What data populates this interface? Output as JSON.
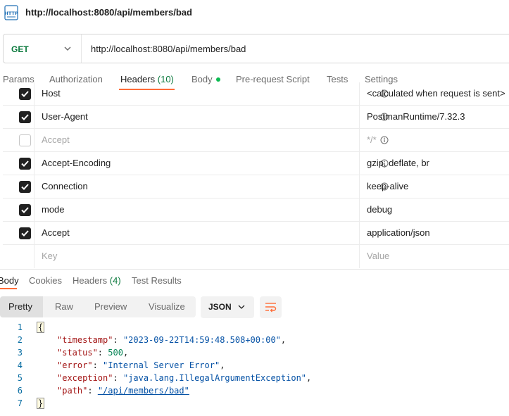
{
  "window": {
    "title": "http://localhost:8080/api/members/bad",
    "icon": "http-file-icon"
  },
  "request": {
    "method": "GET",
    "url": "http://localhost:8080/api/members/bad"
  },
  "request_tabs": [
    {
      "label": "Params"
    },
    {
      "label": "Authorization"
    },
    {
      "label": "Headers",
      "count": "(10)"
    },
    {
      "label": "Body"
    },
    {
      "label": "Pre-request Script"
    },
    {
      "label": "Tests"
    },
    {
      "label": "Settings"
    }
  ],
  "headers": [
    {
      "key": "Host",
      "value": "<calculated when request is sent>",
      "checked": true,
      "info": true
    },
    {
      "key": "User-Agent",
      "value": "PostmanRuntime/7.32.3",
      "checked": true,
      "info": true
    },
    {
      "key": "Accept",
      "value": "*/*",
      "checked": false,
      "info": true
    },
    {
      "key": "Accept-Encoding",
      "value": "gzip, deflate, br",
      "checked": true,
      "info": true
    },
    {
      "key": "Connection",
      "value": "keep-alive",
      "checked": true,
      "info": true
    },
    {
      "key": "mode",
      "value": "debug",
      "checked": true,
      "info": false
    },
    {
      "key": "Accept",
      "value": "application/json",
      "checked": true,
      "info": false
    }
  ],
  "new_header": {
    "key_placeholder": "Key",
    "value_placeholder": "Value"
  },
  "response_tabs": [
    {
      "label": "Body"
    },
    {
      "label": "Cookies"
    },
    {
      "label": "Headers",
      "count": "(4)"
    },
    {
      "label": "Test Results"
    }
  ],
  "format": {
    "options": [
      "Pretty",
      "Raw",
      "Preview",
      "Visualize"
    ],
    "selected": "Pretty",
    "language": "JSON"
  },
  "response_body": {
    "line_numbers": [
      "1",
      "2",
      "3",
      "4",
      "5",
      "6",
      "7"
    ],
    "open_brace": "{",
    "close_brace": "}",
    "fields": [
      {
        "key": "\"timestamp\"",
        "value": "\"2023-09-22T14:59:48.508+00:00\"",
        "trail": ","
      },
      {
        "key": "\"status\"",
        "value": "500",
        "trail": ","
      },
      {
        "key": "\"error\"",
        "value": "\"Internal Server Error\"",
        "trail": ","
      },
      {
        "key": "\"exception\"",
        "value": "\"java.lang.IllegalArgumentException\"",
        "trail": ","
      },
      {
        "key": "\"path\"",
        "value": "\"/api/members/bad\"",
        "trail": ""
      }
    ]
  },
  "colors": {
    "accent": "#ff6c37",
    "method_get": "#0c7a3e",
    "json_key": "#a31515",
    "json_string": "#0451a5",
    "json_number": "#098658"
  }
}
